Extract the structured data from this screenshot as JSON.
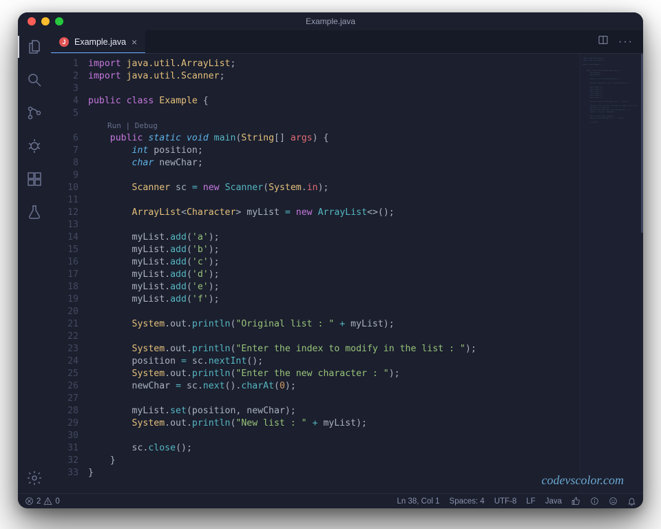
{
  "window": {
    "title": "Example.java"
  },
  "activitybar": {
    "icons": [
      "files-icon",
      "search-icon",
      "source-control-icon",
      "debug-icon",
      "extensions-icon",
      "beaker-icon",
      "gear-icon"
    ]
  },
  "tab": {
    "icon_letter": "J",
    "label": "Example.java",
    "close_glyph": "×"
  },
  "editor_actions": {
    "more_glyph": "···"
  },
  "codelens": {
    "run": "Run",
    "sep": " | ",
    "debug": "Debug"
  },
  "gutter": {
    "lines": [
      "1",
      "2",
      "3",
      "4",
      "5",
      "6",
      "7",
      "8",
      "9",
      "10",
      "11",
      "12",
      "13",
      "14",
      "15",
      "16",
      "17",
      "18",
      "19",
      "20",
      "21",
      "22",
      "23",
      "24",
      "25",
      "26",
      "27",
      "28",
      "29",
      "30",
      "31",
      "32",
      "33"
    ]
  },
  "code": [
    {
      "indent": 0,
      "tokens": [
        [
          "kw",
          "import"
        ],
        [
          "punc",
          " "
        ],
        [
          "pkg",
          "java.util.ArrayList"
        ],
        [
          "punc",
          ";"
        ]
      ]
    },
    {
      "indent": 0,
      "tokens": [
        [
          "kw",
          "import"
        ],
        [
          "punc",
          " "
        ],
        [
          "pkg",
          "java.util.Scanner"
        ],
        [
          "punc",
          ";"
        ]
      ]
    },
    {
      "indent": 0,
      "tokens": []
    },
    {
      "indent": 0,
      "tokens": [
        [
          "kw",
          "public"
        ],
        [
          "punc",
          " "
        ],
        [
          "kw",
          "class"
        ],
        [
          "punc",
          " "
        ],
        [
          "type",
          "Example"
        ],
        [
          "punc",
          " {"
        ]
      ]
    },
    {
      "indent": 0,
      "tokens": []
    },
    {
      "codelens": true
    },
    {
      "indent": 1,
      "tokens": [
        [
          "kw",
          "public"
        ],
        [
          "punc",
          " "
        ],
        [
          "kw2",
          "static"
        ],
        [
          "punc",
          " "
        ],
        [
          "kw2",
          "void"
        ],
        [
          "punc",
          " "
        ],
        [
          "fn",
          "main"
        ],
        [
          "punc",
          "("
        ],
        [
          "type",
          "String"
        ],
        [
          "punc",
          "[] "
        ],
        [
          "varred",
          "args"
        ],
        [
          "punc",
          ") {"
        ]
      ]
    },
    {
      "indent": 2,
      "tokens": [
        [
          "kw2",
          "int"
        ],
        [
          "punc",
          " position;"
        ]
      ]
    },
    {
      "indent": 2,
      "tokens": [
        [
          "kw2",
          "char"
        ],
        [
          "punc",
          " newChar;"
        ]
      ]
    },
    {
      "indent": 0,
      "tokens": []
    },
    {
      "indent": 2,
      "tokens": [
        [
          "type",
          "Scanner"
        ],
        [
          "punc",
          " sc "
        ],
        [
          "op",
          "="
        ],
        [
          "punc",
          " "
        ],
        [
          "kw",
          "new"
        ],
        [
          "punc",
          " "
        ],
        [
          "fn",
          "Scanner"
        ],
        [
          "punc",
          "("
        ],
        [
          "type",
          "System"
        ],
        [
          "punc",
          "."
        ],
        [
          "varred",
          "in"
        ],
        [
          "punc",
          ");"
        ]
      ]
    },
    {
      "indent": 0,
      "tokens": []
    },
    {
      "indent": 2,
      "tokens": [
        [
          "type",
          "ArrayList"
        ],
        [
          "punc",
          "<"
        ],
        [
          "type",
          "Character"
        ],
        [
          "punc",
          "> myList "
        ],
        [
          "op",
          "="
        ],
        [
          "punc",
          " "
        ],
        [
          "kw",
          "new"
        ],
        [
          "punc",
          " "
        ],
        [
          "fn",
          "ArrayList"
        ],
        [
          "punc",
          "<>();"
        ]
      ]
    },
    {
      "indent": 0,
      "tokens": []
    },
    {
      "indent": 2,
      "tokens": [
        [
          "punc",
          "myList."
        ],
        [
          "fn",
          "add"
        ],
        [
          "punc",
          "("
        ],
        [
          "str",
          "'a'"
        ],
        [
          "punc",
          ");"
        ]
      ]
    },
    {
      "indent": 2,
      "tokens": [
        [
          "punc",
          "myList."
        ],
        [
          "fn",
          "add"
        ],
        [
          "punc",
          "("
        ],
        [
          "str",
          "'b'"
        ],
        [
          "punc",
          ");"
        ]
      ]
    },
    {
      "indent": 2,
      "tokens": [
        [
          "punc",
          "myList."
        ],
        [
          "fn",
          "add"
        ],
        [
          "punc",
          "("
        ],
        [
          "str",
          "'c'"
        ],
        [
          "punc",
          ");"
        ]
      ]
    },
    {
      "indent": 2,
      "tokens": [
        [
          "punc",
          "myList."
        ],
        [
          "fn",
          "add"
        ],
        [
          "punc",
          "("
        ],
        [
          "str",
          "'d'"
        ],
        [
          "punc",
          ");"
        ]
      ]
    },
    {
      "indent": 2,
      "tokens": [
        [
          "punc",
          "myList."
        ],
        [
          "fn",
          "add"
        ],
        [
          "punc",
          "("
        ],
        [
          "str",
          "'e'"
        ],
        [
          "punc",
          ");"
        ]
      ]
    },
    {
      "indent": 2,
      "tokens": [
        [
          "punc",
          "myList."
        ],
        [
          "fn",
          "add"
        ],
        [
          "punc",
          "("
        ],
        [
          "str",
          "'f'"
        ],
        [
          "punc",
          ");"
        ]
      ]
    },
    {
      "indent": 0,
      "tokens": []
    },
    {
      "indent": 2,
      "tokens": [
        [
          "type",
          "System"
        ],
        [
          "punc",
          ".out."
        ],
        [
          "fn",
          "println"
        ],
        [
          "punc",
          "("
        ],
        [
          "str",
          "\"Original list : \""
        ],
        [
          "punc",
          " "
        ],
        [
          "op",
          "+"
        ],
        [
          "punc",
          " myList);"
        ]
      ]
    },
    {
      "indent": 0,
      "tokens": []
    },
    {
      "indent": 2,
      "tokens": [
        [
          "type",
          "System"
        ],
        [
          "punc",
          ".out."
        ],
        [
          "fn",
          "println"
        ],
        [
          "punc",
          "("
        ],
        [
          "str",
          "\"Enter the index to modify in the list : \""
        ],
        [
          "punc",
          ");"
        ]
      ]
    },
    {
      "indent": 2,
      "tokens": [
        [
          "punc",
          "position "
        ],
        [
          "op",
          "="
        ],
        [
          "punc",
          " sc."
        ],
        [
          "fn",
          "nextInt"
        ],
        [
          "punc",
          "();"
        ]
      ]
    },
    {
      "indent": 2,
      "tokens": [
        [
          "type",
          "System"
        ],
        [
          "punc",
          ".out."
        ],
        [
          "fn",
          "println"
        ],
        [
          "punc",
          "("
        ],
        [
          "str",
          "\"Enter the new character : \""
        ],
        [
          "punc",
          ");"
        ]
      ]
    },
    {
      "indent": 2,
      "tokens": [
        [
          "punc",
          "newChar "
        ],
        [
          "op",
          "="
        ],
        [
          "punc",
          " sc."
        ],
        [
          "fn",
          "next"
        ],
        [
          "punc",
          "()."
        ],
        [
          "fn",
          "charAt"
        ],
        [
          "punc",
          "("
        ],
        [
          "num",
          "0"
        ],
        [
          "punc",
          ");"
        ]
      ]
    },
    {
      "indent": 0,
      "tokens": []
    },
    {
      "indent": 2,
      "tokens": [
        [
          "punc",
          "myList."
        ],
        [
          "fn",
          "set"
        ],
        [
          "punc",
          "(position, newChar);"
        ]
      ]
    },
    {
      "indent": 2,
      "tokens": [
        [
          "type",
          "System"
        ],
        [
          "punc",
          ".out."
        ],
        [
          "fn",
          "println"
        ],
        [
          "punc",
          "("
        ],
        [
          "str",
          "\"New list : \""
        ],
        [
          "punc",
          " "
        ],
        [
          "op",
          "+"
        ],
        [
          "punc",
          " myList);"
        ]
      ]
    },
    {
      "indent": 0,
      "tokens": []
    },
    {
      "indent": 2,
      "tokens": [
        [
          "punc",
          "sc."
        ],
        [
          "fn",
          "close"
        ],
        [
          "punc",
          "();"
        ]
      ]
    },
    {
      "indent": 1,
      "tokens": [
        [
          "punc",
          "}"
        ]
      ]
    },
    {
      "indent": 0,
      "tokens": [
        [
          "punc",
          "}"
        ]
      ]
    }
  ],
  "status": {
    "errors": "2",
    "warnings": "0",
    "cursor": "Ln 38, Col 1",
    "spaces": "Spaces: 4",
    "encoding": "UTF-8",
    "eol": "LF",
    "language": "Java"
  },
  "watermark": "codevscolor.com"
}
